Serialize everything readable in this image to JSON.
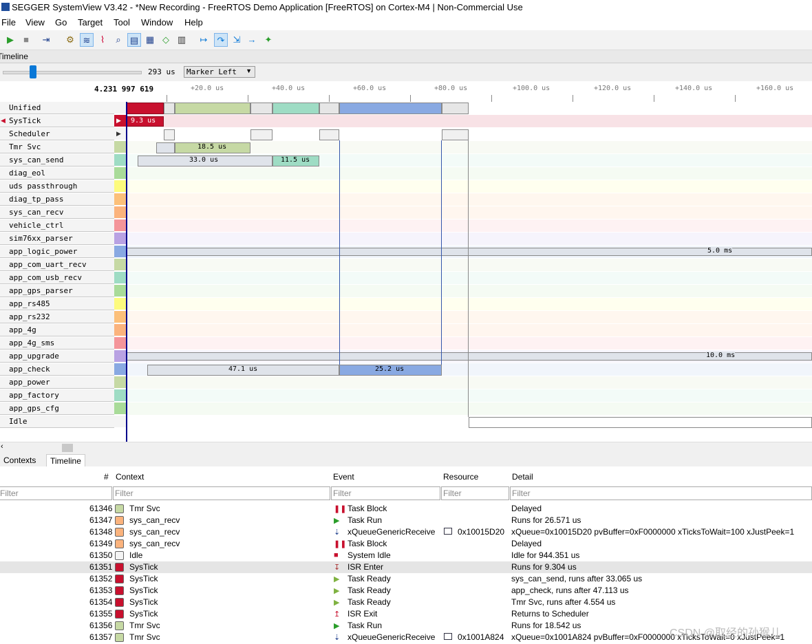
{
  "window": {
    "title": "SEGGER SystemView V3.42 - *New Recording - FreeRTOS Demo Application [FreeRTOS] on Cortex-M4 | Non-Commercial Use"
  },
  "menu": [
    "File",
    "View",
    "Go",
    "Target",
    "Tool",
    "Window",
    "Help"
  ],
  "toolbar": {
    "icons": [
      "play-icon",
      "stop-icon",
      "goto-end-icon",
      "system-icon",
      "timeline-icon",
      "cpu-load-icon",
      "analysis-icon",
      "log-icon",
      "contexts-icon",
      "marker-icon",
      "table-icon",
      "step-forward-icon",
      "step-over-icon",
      "step-into-icon",
      "step-next-icon",
      "settings-icon"
    ]
  },
  "panel": {
    "title": "Timeline"
  },
  "controls": {
    "zoom_value": "293 us",
    "marker_mode": "Marker Left"
  },
  "ruler": {
    "main": "4.231 997 619",
    "ticks": [
      "+20.0 us",
      "+40.0 us",
      "+60.0 us",
      "+80.0 us",
      "+100.0 us",
      "+120.0 us",
      "+140.0 us",
      "+160.0 us"
    ]
  },
  "rows": [
    {
      "name": "Unified",
      "color": "#f4f4f4"
    },
    {
      "name": "SysTick",
      "color": "#c8102e"
    },
    {
      "name": "Scheduler",
      "color": "#f4f4f4"
    },
    {
      "name": "Tmr Svc",
      "color": "#c6d9a4"
    },
    {
      "name": "sys_can_send",
      "color": "#9edcc4"
    },
    {
      "name": "diag_eol",
      "color": "#a9db99"
    },
    {
      "name": "uds passthrough",
      "color": "#fdfb7e"
    },
    {
      "name": "diag_tp_pass",
      "color": "#fcc07a"
    },
    {
      "name": "sys_can_recv",
      "color": "#fbb37d"
    },
    {
      "name": "vehicle_ctrl",
      "color": "#f4959a"
    },
    {
      "name": "sim76xx_parser",
      "color": "#b9a2e3"
    },
    {
      "name": "app_logic_power",
      "color": "#89a9e2"
    },
    {
      "name": "app_com_uart_recv",
      "color": "#c6d9a4"
    },
    {
      "name": "app_com_usb_recv",
      "color": "#9edcc4"
    },
    {
      "name": "app_gps_parser",
      "color": "#a9db99"
    },
    {
      "name": "app_rs485",
      "color": "#fdfb7e"
    },
    {
      "name": "app_rs232",
      "color": "#fcc07a"
    },
    {
      "name": "app_4g",
      "color": "#fbb37d"
    },
    {
      "name": "app_4g_sms",
      "color": "#f4959a"
    },
    {
      "name": "app_upgrade",
      "color": "#b9a2e3"
    },
    {
      "name": "app_check",
      "color": "#89a9e2"
    },
    {
      "name": "app_power",
      "color": "#c6d9a4"
    },
    {
      "name": "app_factory",
      "color": "#9edcc4"
    },
    {
      "name": "app_gps_cfg",
      "color": "#a9db99"
    },
    {
      "name": "Idle",
      "color": "#f4f4f4"
    }
  ],
  "timeline_labels": {
    "systick": "9.3 us",
    "tmr_svc": "18.5 us",
    "can_send_a": "33.0 us",
    "can_send_b": "11.5 us",
    "logic_power": "5.0 ms",
    "upgrade": "10.0 ms",
    "check_a": "47.1 us",
    "check_b": "25.2 us"
  },
  "tabs": [
    "Contexts",
    "Timeline"
  ],
  "events": {
    "headers": {
      "num": "#",
      "context": "Context",
      "event": "Event",
      "resource": "Resource",
      "detail": "Detail"
    },
    "filter_placeholder": "Filter",
    "rows": [
      {
        "num": "61346",
        "ctx": "Tmr Svc",
        "ctx_color": "#c6d9a4",
        "evt": "Task Block",
        "evt_icon": "task-block-icon",
        "res": "",
        "detail": "Delayed"
      },
      {
        "num": "61347",
        "ctx": "sys_can_recv",
        "ctx_color": "#fbb37d",
        "evt": "Task Run",
        "evt_icon": "task-run-icon",
        "res": "",
        "detail": "Runs for 26.571 us"
      },
      {
        "num": "61348",
        "ctx": "sys_can_recv",
        "ctx_color": "#fbb37d",
        "evt": "xQueueGenericReceive",
        "evt_icon": "api-call-icon",
        "res": "0x10015D20",
        "detail": "xQueue=0x10015D20 pvBuffer=0xF0000000 xTicksToWait=100 xJustPeek=1"
      },
      {
        "num": "61349",
        "ctx": "sys_can_recv",
        "ctx_color": "#fbb37d",
        "evt": "Task Block",
        "evt_icon": "task-block-icon",
        "res": "",
        "detail": "Delayed"
      },
      {
        "num": "61350",
        "ctx": "Idle",
        "ctx_color": "#f4f4f4",
        "evt": "System Idle",
        "evt_icon": "system-idle-icon",
        "res": "",
        "detail": "Idle for 944.351 us"
      },
      {
        "num": "61351",
        "ctx": "SysTick",
        "ctx_color": "#c8102e",
        "evt": "ISR Enter",
        "evt_icon": "isr-enter-icon",
        "res": "",
        "detail": "Runs for 9.304 us"
      },
      {
        "num": "61352",
        "ctx": "SysTick",
        "ctx_color": "#c8102e",
        "evt": "Task Ready",
        "evt_icon": "task-ready-icon",
        "res": "",
        "detail": "sys_can_send, runs after 33.065 us"
      },
      {
        "num": "61353",
        "ctx": "SysTick",
        "ctx_color": "#c8102e",
        "evt": "Task Ready",
        "evt_icon": "task-ready-icon",
        "res": "",
        "detail": "app_check, runs after 47.113 us"
      },
      {
        "num": "61354",
        "ctx": "SysTick",
        "ctx_color": "#c8102e",
        "evt": "Task Ready",
        "evt_icon": "task-ready-icon",
        "res": "",
        "detail": "Tmr Svc, runs after 4.554 us"
      },
      {
        "num": "61355",
        "ctx": "SysTick",
        "ctx_color": "#c8102e",
        "evt": "ISR Exit",
        "evt_icon": "isr-exit-icon",
        "res": "",
        "detail": "Returns to Scheduler"
      },
      {
        "num": "61356",
        "ctx": "Tmr Svc",
        "ctx_color": "#c6d9a4",
        "evt": "Task Run",
        "evt_icon": "task-run-icon",
        "res": "",
        "detail": "Runs for 18.542 us"
      },
      {
        "num": "61357",
        "ctx": "Tmr Svc",
        "ctx_color": "#c6d9a4",
        "evt": "xQueueGenericReceive",
        "evt_icon": "api-call-icon",
        "res": "0x1001A824",
        "detail": "xQueue=0x1001A824 pvBuffer=0xF0000000 xTicksToWait=0 xJustPeek=1"
      }
    ]
  },
  "watermark": "CSDN @取经的孙猴儿"
}
